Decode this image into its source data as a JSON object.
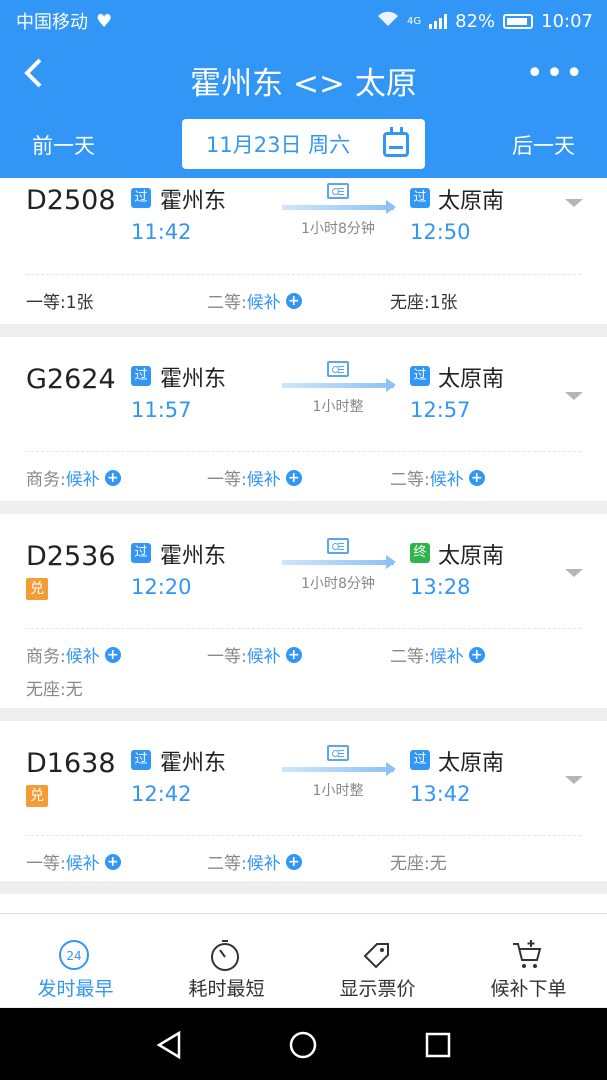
{
  "status_bar": {
    "carrier": "中国移动",
    "network": "4G",
    "battery": "82%",
    "time": "10:07"
  },
  "header": {
    "back": "‹",
    "title": "霍州东 <> 太原",
    "more": "•••"
  },
  "date_bar": {
    "prev": "前一天",
    "date": "11月23日 周六",
    "next": "后一天"
  },
  "trains": [
    {
      "number": "D2508",
      "dui": "",
      "from_badge": "过",
      "from": "霍州东",
      "depart": "11:42",
      "duration": "1小时8分钟",
      "to_badge": "过",
      "to": "太原南",
      "arrive": "12:50",
      "seats": [
        {
          "label": "一等:",
          "value": "1张",
          "houbu": ""
        },
        {
          "label": "二等:",
          "value": "",
          "houbu": "候补"
        },
        {
          "label": "无座:",
          "value": "1张",
          "houbu": ""
        }
      ]
    },
    {
      "number": "G2624",
      "dui": "",
      "from_badge": "过",
      "from": "霍州东",
      "depart": "11:57",
      "duration": "1小时整",
      "to_badge": "过",
      "to": "太原南",
      "arrive": "12:57",
      "seats": [
        {
          "label": "商务:",
          "value": "",
          "houbu": "候补"
        },
        {
          "label": "一等:",
          "value": "",
          "houbu": "候补"
        },
        {
          "label": "二等:",
          "value": "",
          "houbu": "候补"
        }
      ]
    },
    {
      "number": "D2536",
      "dui": "兑",
      "from_badge": "过",
      "from": "霍州东",
      "depart": "12:20",
      "duration": "1小时8分钟",
      "to_badge": "终",
      "to": "太原南",
      "arrive": "13:28",
      "seats": [
        {
          "label": "商务:",
          "value": "",
          "houbu": "候补"
        },
        {
          "label": "一等:",
          "value": "",
          "houbu": "候补"
        },
        {
          "label": "二等:",
          "value": "",
          "houbu": "候补"
        },
        {
          "label": "无座:",
          "value": "无",
          "houbu": ""
        }
      ]
    },
    {
      "number": "D1638",
      "dui": "兑",
      "from_badge": "过",
      "from": "霍州东",
      "depart": "12:42",
      "duration": "1小时整",
      "to_badge": "过",
      "to": "太原南",
      "arrive": "13:42",
      "seats": [
        {
          "label": "一等:",
          "value": "",
          "houbu": "候补"
        },
        {
          "label": "二等:",
          "value": "",
          "houbu": "候补"
        },
        {
          "label": "无座:",
          "value": "无",
          "houbu": ""
        }
      ]
    }
  ],
  "tabs": [
    {
      "label": "发时最早",
      "icon": "clock-24-icon",
      "icon_text": "24",
      "active": true
    },
    {
      "label": "耗时最短",
      "icon": "timer-icon",
      "active": false
    },
    {
      "label": "显示票价",
      "icon": "price-tag-icon",
      "active": false
    },
    {
      "label": "候补下单",
      "icon": "cart-icon",
      "active": false
    }
  ],
  "colors": {
    "primary": "#3296f7",
    "dui": "#f39c38",
    "terminal": "#2fb34a"
  }
}
